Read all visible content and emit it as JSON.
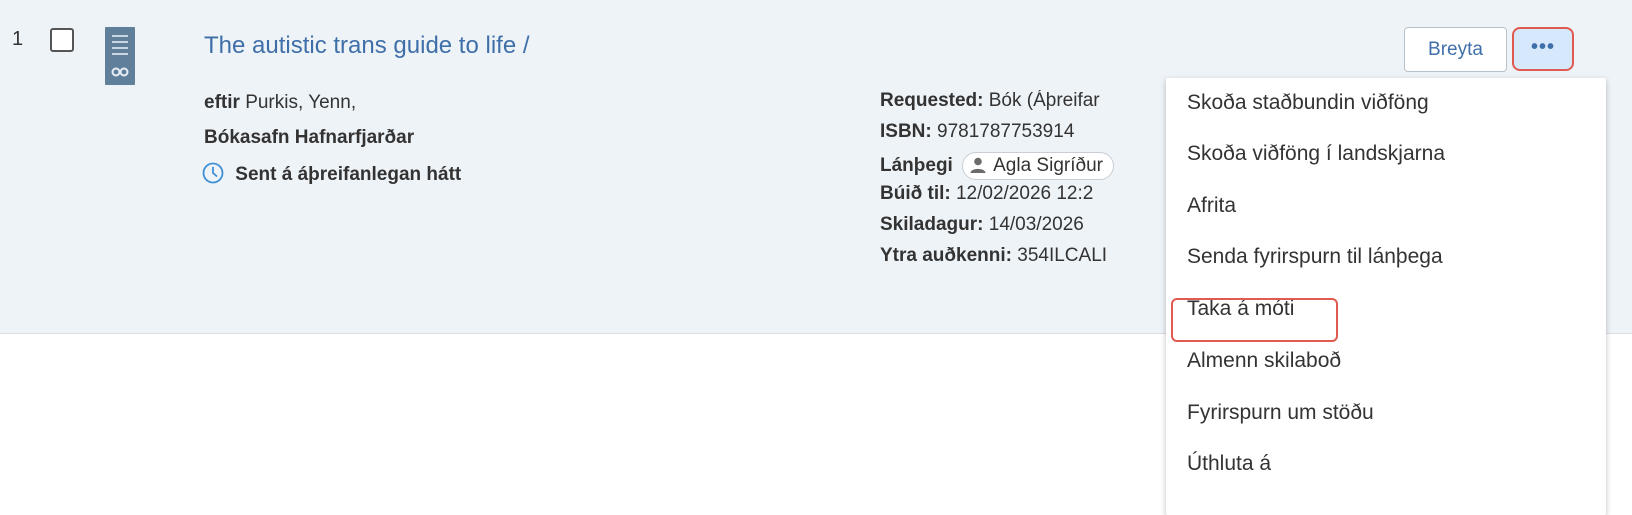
{
  "item": {
    "number": "1",
    "title": "The autistic trans guide to life /",
    "author_label": "eftir",
    "author_value": "Purkis, Yenn,",
    "library": "Bókasafn Hafnarfjarðar",
    "status": "Sent á áþreifanlegan hátt",
    "meta": {
      "requested_label": "Requested:",
      "requested_value": "Bók (Áþreifar",
      "isbn_label": "ISBN:",
      "isbn_value": "9781787753914",
      "patron_label": "Lánþegi",
      "patron_value": "Agla Sigríður",
      "created_label": "Búið til:",
      "created_value": "12/02/2026 12:2",
      "due_label": "Skiladagur:",
      "due_value": "14/03/2026",
      "external_label": "Ytra auðkenni:",
      "external_value": "354ILCALI"
    }
  },
  "actions": {
    "edit_label": "Breyta",
    "more_label": "•••"
  },
  "menu": {
    "items": [
      "Skoða staðbundin viðföng",
      "Skoða viðföng í landskjarna",
      "Afrita",
      "Senda fyrirspurn til lánþega",
      "Taka á móti",
      "Almenn skilaboð",
      "Fyrirspurn um stöðu",
      "Úthluta á"
    ]
  },
  "colors": {
    "row_background": "#eef3f7",
    "link": "#3f6fa8",
    "highlight": "#e05a4f",
    "more_button_bg": "#d6e8fb"
  },
  "icons": {
    "status": "clock-icon",
    "patron": "user-icon",
    "cover": "book-cover-thumbnail"
  }
}
